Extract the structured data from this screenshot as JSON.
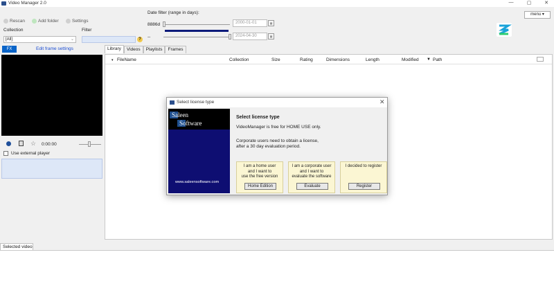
{
  "window": {
    "title": "Video Manager 2.0",
    "min": "—",
    "max": "▢",
    "close": "✕"
  },
  "toolbar": {
    "rescan": "Rescan",
    "add_folder": "Add folder",
    "settings": "Settings"
  },
  "filters": {
    "collection_label": "Collection",
    "collection_value": "[All]",
    "filter_label": "Filter",
    "help": "?",
    "date_filter_label": "Date filter (range in days):",
    "range_days": "8886d",
    "range_sep": "--",
    "date_from": "2000-01-01",
    "date_to": "2024-04-30"
  },
  "menu_button": "menu ▾",
  "left": {
    "fx": "FX",
    "edit_frame": "Edit frame settings",
    "time": "0:00:00",
    "external_player": "Use external player"
  },
  "tabs": [
    "Library",
    "Videos",
    "Playlists",
    "Frames"
  ],
  "columns": [
    "FileName",
    "Collection",
    "Size",
    "Rating",
    "Dimensions",
    "Length",
    "Modified",
    "Path"
  ],
  "sort_indicator": "▼",
  "bottom_tab": "Selected video",
  "dialog": {
    "title": "Select license type",
    "heading": "Select license type",
    "line1": "VideoManager is free for HOME USE only.",
    "line2": "Corporate users need to obtain a license,",
    "line3": "after a 30 day evaluation period.",
    "brand_top": "Saleen",
    "brand_bottom": "Software",
    "url": "www.saleensoftware.com",
    "options": [
      {
        "text": [
          "I am a home user",
          "and I want to",
          "use the free version"
        ],
        "button": "Home Edition"
      },
      {
        "text": [
          "I am a corporate user",
          "and I want to",
          "evaluate the software"
        ],
        "button": "Evaluate"
      },
      {
        "text": [
          "I decided to register"
        ],
        "button": "Register"
      }
    ]
  },
  "colors": {
    "accent": "#0a64c8",
    "banner": "#0e0e72",
    "option_bg": "#fbf6d3",
    "link": "#1a4bd0"
  }
}
